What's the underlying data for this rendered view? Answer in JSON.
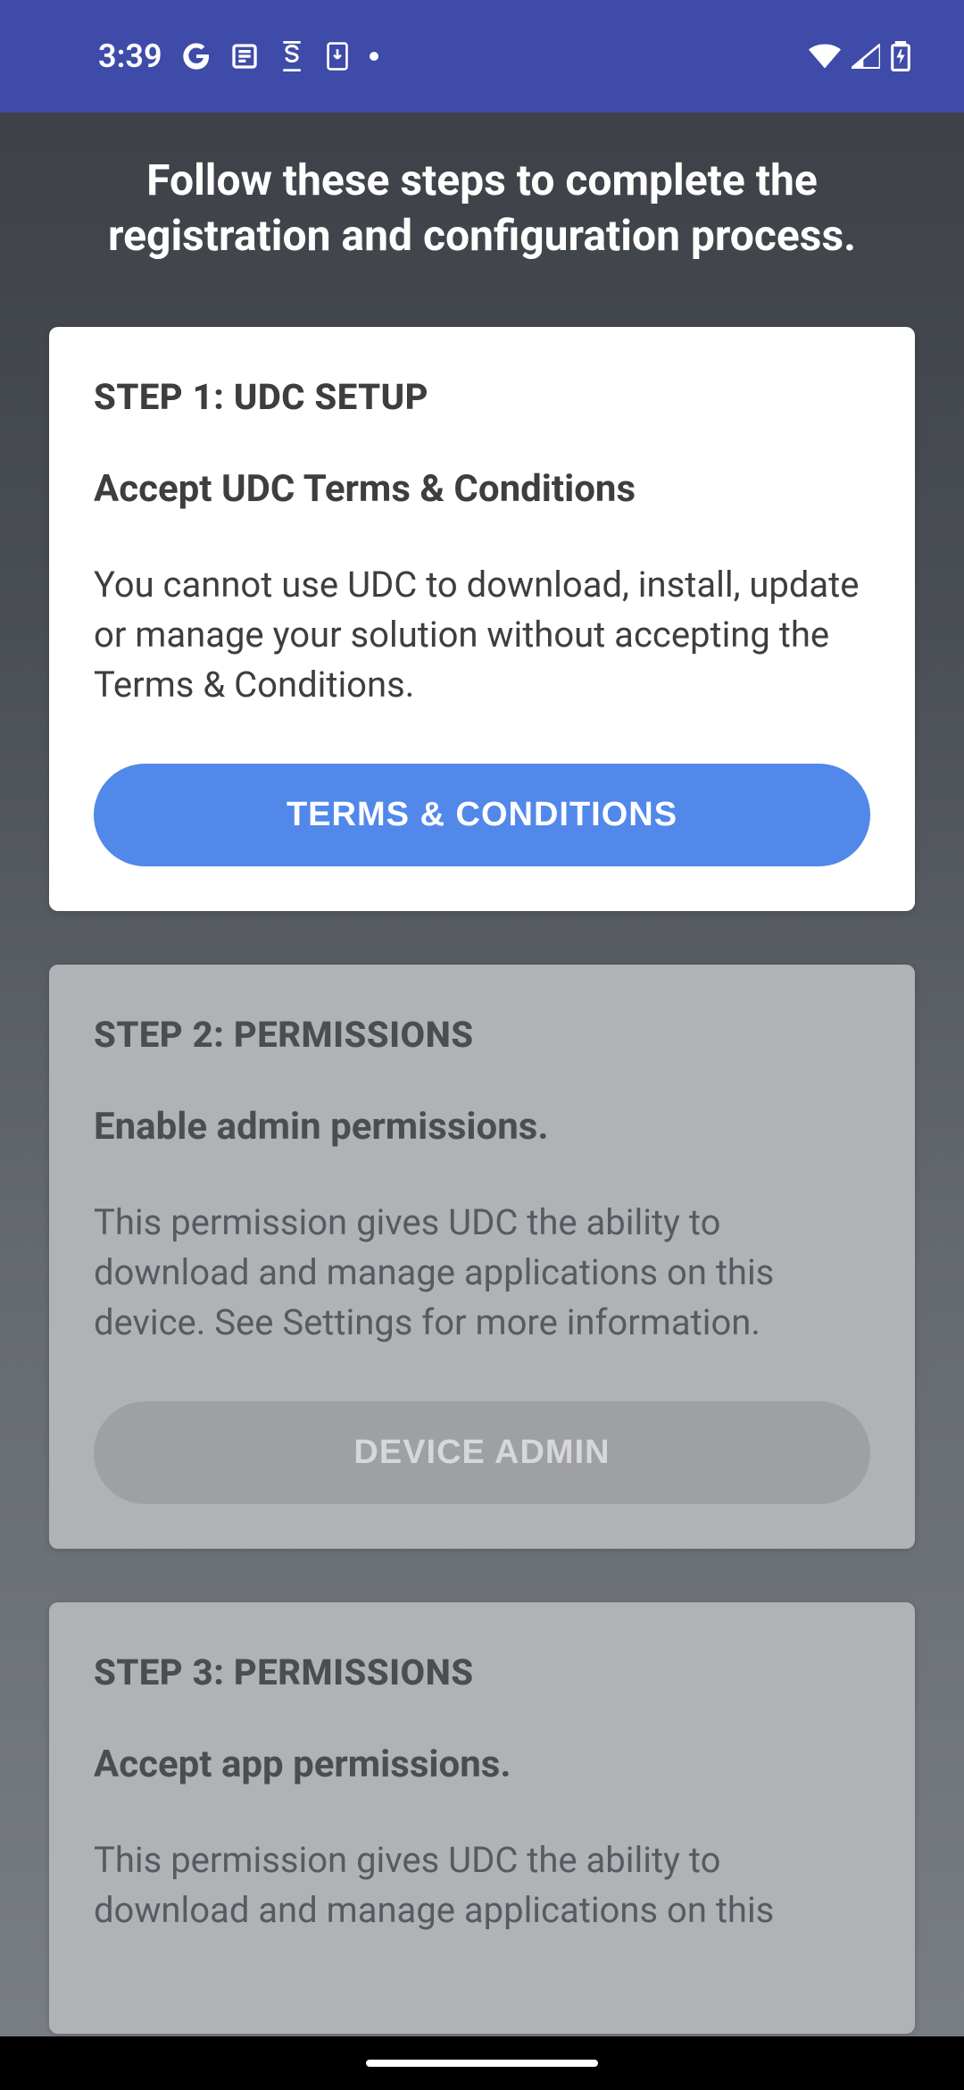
{
  "status_bar": {
    "time": "3:39"
  },
  "page": {
    "title": "Follow these steps to complete the registration and configuration process."
  },
  "steps": [
    {
      "title": "STEP 1: UDC SETUP",
      "subtitle": "Accept UDC Terms & Conditions",
      "body": "You cannot use UDC to download, install, update or manage your solution without accepting the Terms & Conditions.",
      "button_label": "TERMS & CONDITIONS",
      "active": true
    },
    {
      "title": "STEP 2: PERMISSIONS",
      "subtitle": "Enable admin permissions.",
      "body": "This permission gives UDC the ability to download and manage applications on this device. See Settings for more information.",
      "button_label": "DEVICE ADMIN",
      "active": false
    },
    {
      "title": "STEP 3: PERMISSIONS",
      "subtitle": "Accept app permissions.",
      "body": "This permission gives UDC the ability to download and manage applications on this",
      "button_label": "",
      "active": false
    }
  ]
}
